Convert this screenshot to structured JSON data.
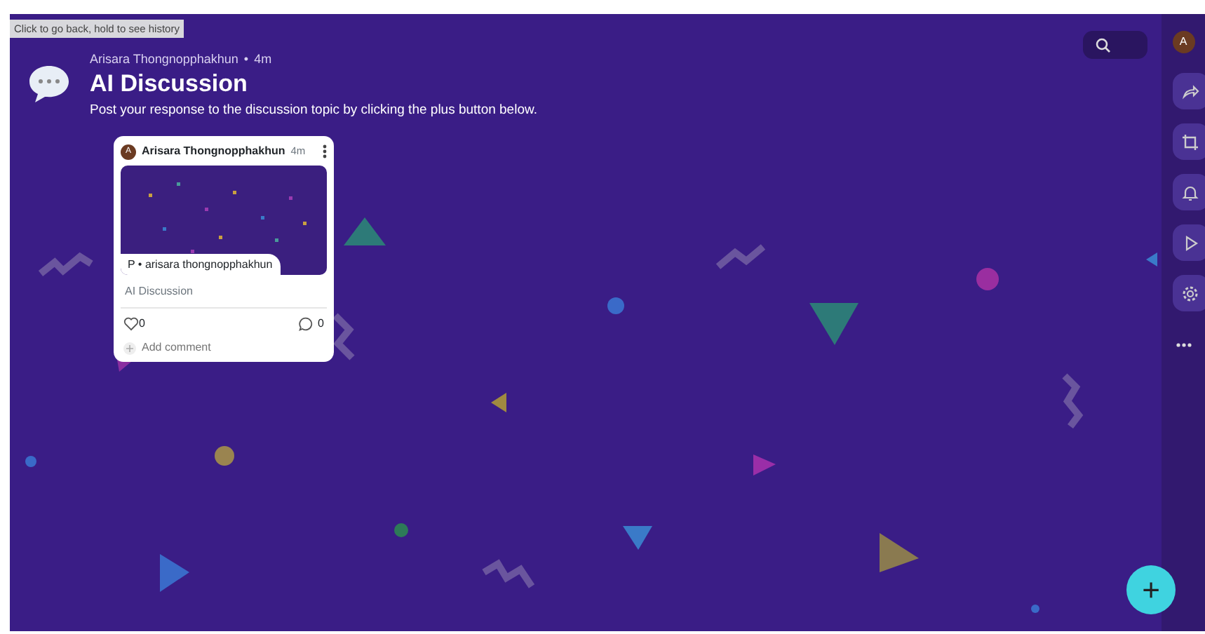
{
  "tooltip": "Click to go back, hold to see history",
  "header": {
    "author": "Arisara Thongnopphakhun",
    "separator": "•",
    "time": "4m",
    "title": "AI Discussion",
    "description": "Post your response to the discussion topic by clicking the plus button below."
  },
  "posts": [
    {
      "author_initial": "A",
      "author": "Arisara Thongnopphakhun",
      "time": "4m",
      "attachment_label": "P • arisara thongnopphakhun",
      "caption": "AI Discussion",
      "likes": "0",
      "comments": "0",
      "comment_placeholder": "Add comment"
    }
  ],
  "user": {
    "initial": "A"
  },
  "add_button": "+"
}
